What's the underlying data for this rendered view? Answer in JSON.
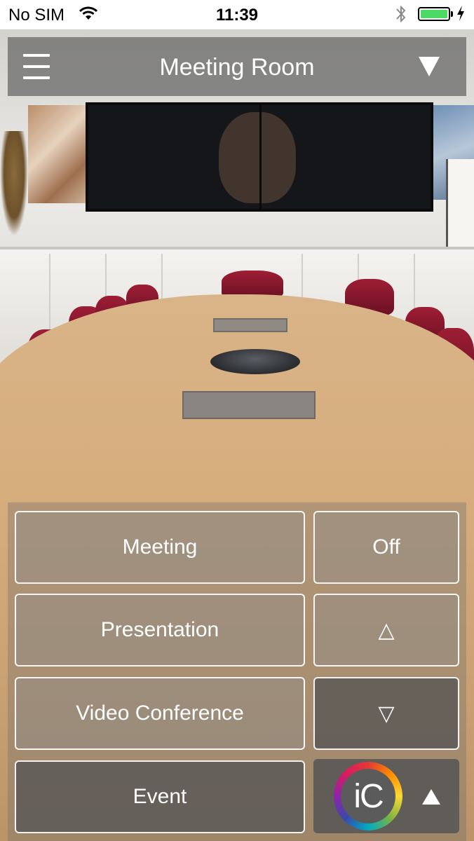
{
  "status_bar": {
    "carrier": "No SIM",
    "time": "11:39",
    "wifi_icon": "wifi-icon",
    "bluetooth_icon": "bluetooth-icon",
    "battery_icon": "battery-icon",
    "battery_level": 1.0,
    "charging_icon": "bolt-icon"
  },
  "header": {
    "title": "Meeting Room",
    "menu_icon": "hamburger-menu-icon",
    "dropdown_icon": "triangle-down-icon"
  },
  "controls": {
    "scenes": [
      {
        "label": "Meeting"
      },
      {
        "label": "Presentation"
      },
      {
        "label": "Video Conference"
      },
      {
        "label": "Event"
      }
    ],
    "power_label": "Off",
    "up_label": "△",
    "down_label": "▽",
    "brand_logo_text": "iC",
    "expand_icon": "triangle-up-icon"
  },
  "colors": {
    "header_bg": "#646464",
    "button_border": "#ffffff",
    "text": "#ffffff",
    "battery_fill": "#4cd964"
  }
}
